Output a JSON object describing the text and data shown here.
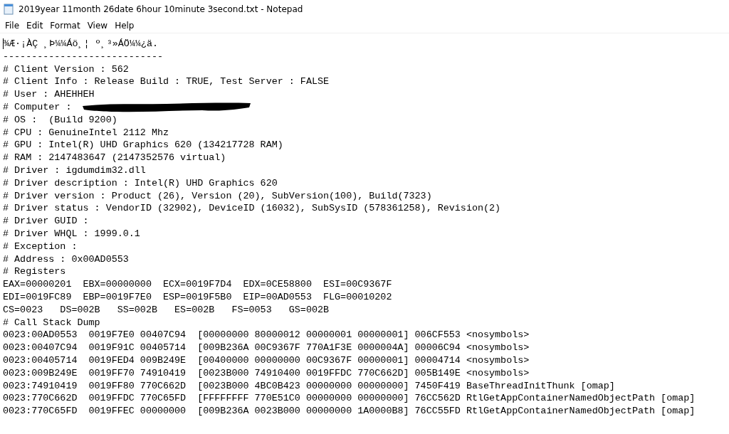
{
  "window": {
    "title": "2019year 11month 26date 6hour 10minute 3second.txt - Notepad"
  },
  "menu": [
    "File",
    "Edit",
    "Format",
    "View",
    "Help"
  ],
  "editor": {
    "lines": [
      {
        "text": "¾Æ·¡ÀÇ ¸Þ¼¼Áö¸¦ º¸³»ÁÖ¼¼¿ä."
      },
      {
        "text": "----------------------------"
      },
      {
        "text": "# Client Version : 562"
      },
      {
        "text": "# Client Info : Release Build : TRUE, Test Server : FALSE"
      },
      {
        "text": "# User : AHEHHEH"
      },
      {
        "text": "# Computer : ",
        "redacted": true
      },
      {
        "text": "# OS :  (Build 9200)"
      },
      {
        "text": "# CPU : GenuineIntel 2112 Mhz"
      },
      {
        "text": "# GPU : Intel(R) UHD Graphics 620 (134217728 RAM)"
      },
      {
        "text": "# RAM : 2147483647 (2147352576 virtual)"
      },
      {
        "text": "# Driver : igdumdim32.dll"
      },
      {
        "text": "# Driver description : Intel(R) UHD Graphics 620"
      },
      {
        "text": "# Driver version : Product (26), Version (20), SubVersion(100), Build(7323)"
      },
      {
        "text": "# Driver status : VendorID (32902), DeviceID (16032), SubSysID (578361258), Revision(2)"
      },
      {
        "text": "# Driver GUID :"
      },
      {
        "text": "# Driver WHQL : 1999.0.1"
      },
      {
        "text": "# Exception :"
      },
      {
        "text": "# Address : 0x00AD0553"
      },
      {
        "text": "# Registers"
      },
      {
        "text": "EAX=00000201  EBX=00000000  ECX=0019F7D4  EDX=0CE58800  ESI=00C9367F"
      },
      {
        "text": "EDI=0019FC89  EBP=0019F7E0  ESP=0019F5B0  EIP=00AD0553  FLG=00010202"
      },
      {
        "text": "CS=0023   DS=002B   SS=002B   ES=002B   FS=0053   GS=002B"
      },
      {
        "text": "# Call Stack Dump"
      },
      {
        "text": "0023:00AD0553  0019F7E0 00407C94  [00000000 80000012 00000001 00000001] 006CF553 <nosymbols>"
      },
      {
        "text": "0023:00407C94  0019F91C 00405714  [009B236A 00C9367F 770A1F3E 0000004A] 00006C94 <nosymbols>"
      },
      {
        "text": "0023:00405714  0019FED4 009B249E  [00400000 00000000 00C9367F 00000001] 00004714 <nosymbols>"
      },
      {
        "text": "0023:009B249E  0019FF70 74910419  [0023B000 74910400 0019FFDC 770C662D] 005B149E <nosymbols>"
      },
      {
        "text": "0023:74910419  0019FF80 770C662D  [0023B000 4BC0B423 00000000 00000000] 7450F419 BaseThreadInitThunk [omap]"
      },
      {
        "text": "0023:770C662D  0019FFDC 770C65FD  [FFFFFFFF 770E51C0 00000000 00000000] 76CC562D RtlGetAppContainerNamedObjectPath [omap]"
      },
      {
        "text": "0023:770C65FD  0019FFEC 00000000  [009B236A 0023B000 00000000 1A0000B8] 76CC55FD RtlGetAppContainerNamedObjectPath [omap]"
      }
    ]
  }
}
